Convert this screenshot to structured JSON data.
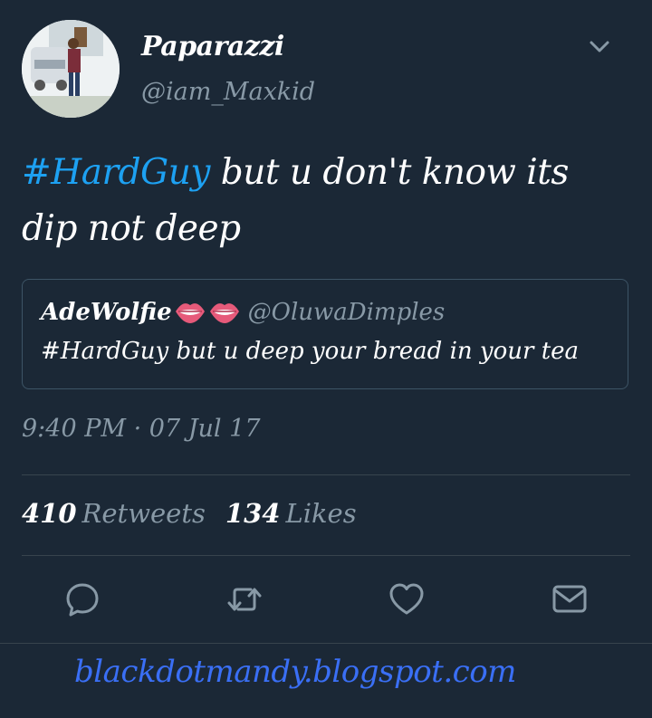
{
  "user": {
    "name": "Paparazzi",
    "handle": "@iam_Maxkid"
  },
  "tweet": {
    "hashtag": "#HardGuy",
    "text_rest": " but u don't know its dip not deep"
  },
  "quote": {
    "name": "AdeWolfie",
    "emoji": "👄👄",
    "handle": "@OluwaDimples",
    "text": "#HardGuy but u deep your bread in your tea"
  },
  "meta": {
    "timestamp": "9:40 PM · 07 Jul 17"
  },
  "stats": {
    "retweets_count": "410",
    "retweets_label": "Retweets",
    "likes_count": "134",
    "likes_label": "Likes"
  },
  "icons": {
    "reply": "reply-icon",
    "retweet": "retweet-icon",
    "like": "heart-icon",
    "message": "envelope-icon",
    "menu": "chevron-down-icon"
  },
  "colors": {
    "background": "#1b2836",
    "accent": "#1da1f2",
    "muted": "#8899a6",
    "watermark": "#3a6ff5"
  },
  "watermark": {
    "text": "blackdotmandy.blogspot.com"
  }
}
